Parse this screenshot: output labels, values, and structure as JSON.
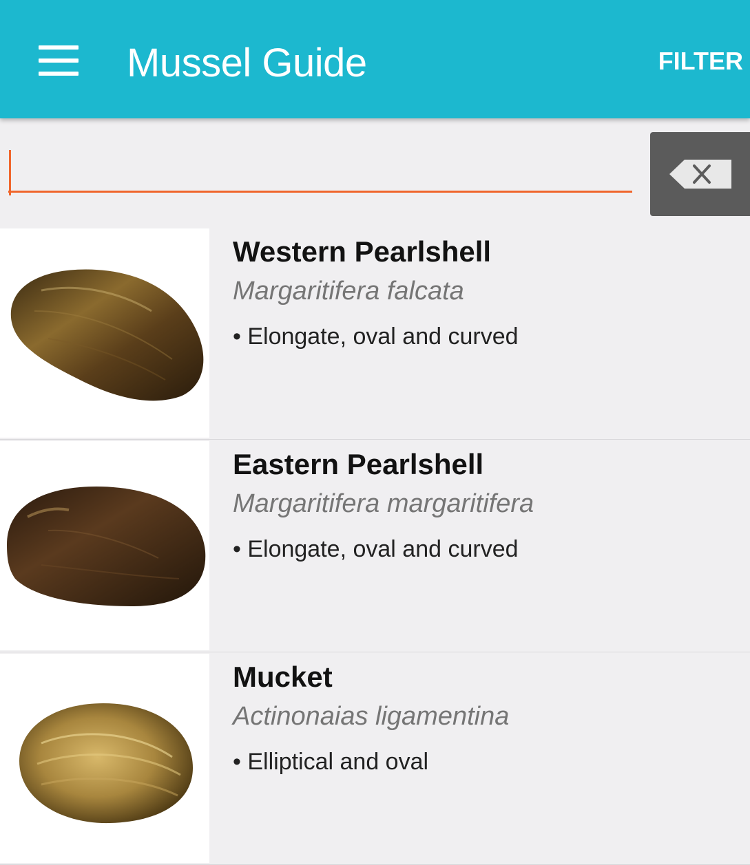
{
  "app_bar": {
    "title": "Mussel Guide",
    "filter_label": "FILTER",
    "menu_icon": "hamburger-menu-icon",
    "background_color": "#1cb8cf"
  },
  "search": {
    "value": "",
    "placeholder": "",
    "clear_icon": "backspace-clear-icon",
    "underline_color": "#f0662c"
  },
  "species": [
    {
      "common_name": "Western Pearlshell",
      "latin_name": "Margaritifera falcata",
      "trait": "• Elongate, oval and curved",
      "image": "western-pearlshell-shell-image"
    },
    {
      "common_name": "Eastern Pearlshell",
      "latin_name": "Margaritifera margaritifera",
      "trait": "• Elongate, oval and curved",
      "image": "eastern-pearlshell-shell-image"
    },
    {
      "common_name": "Mucket",
      "latin_name": "Actinonaias ligamentina",
      "trait": "• Elliptical and oval",
      "image": "mucket-shell-image"
    }
  ]
}
